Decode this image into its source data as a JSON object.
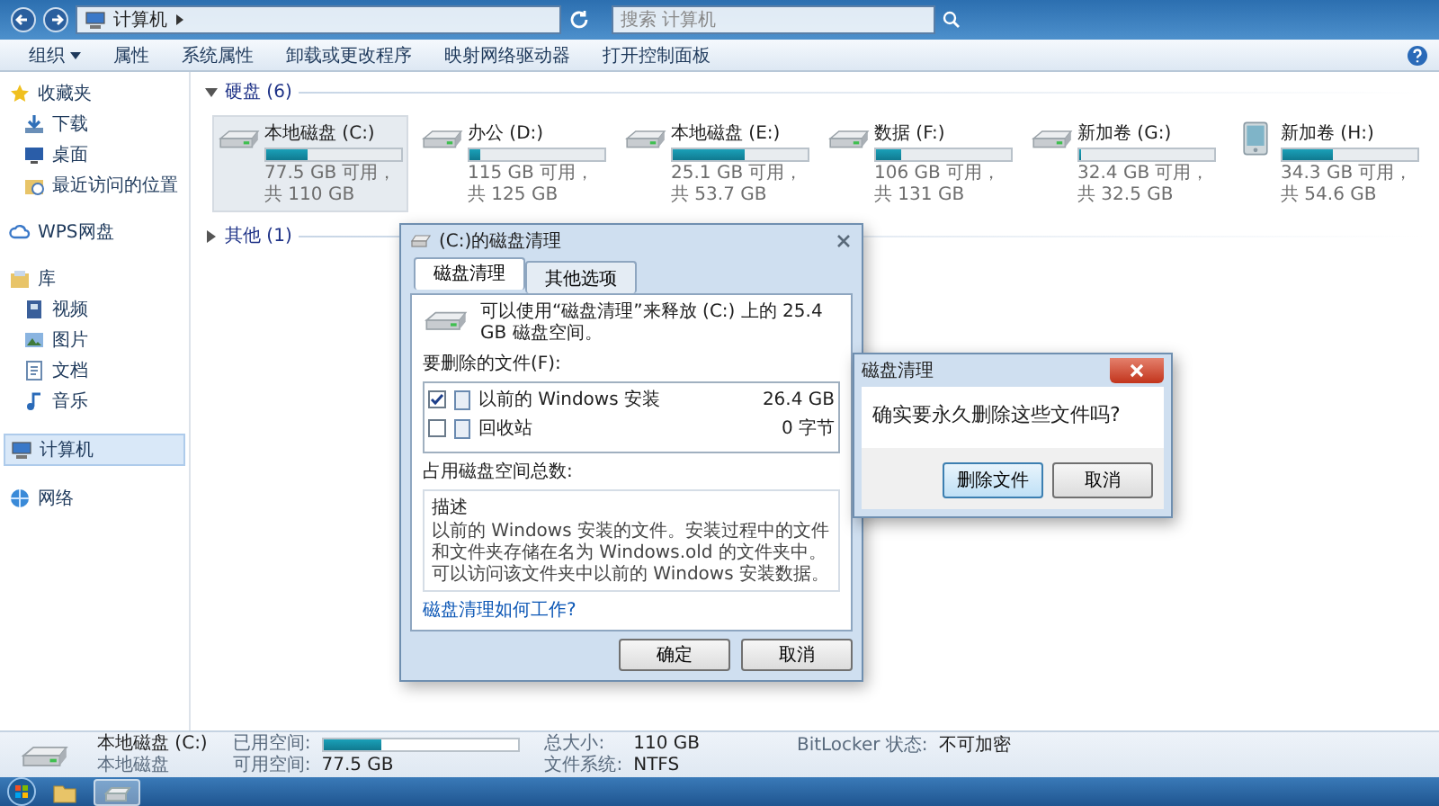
{
  "window": {
    "address": "计算机",
    "search": {
      "placeholder": "搜索 计算机"
    }
  },
  "toolbar": [
    {
      "label": "组织",
      "menu": true
    },
    {
      "label": "属性",
      "menu": false
    },
    {
      "label": "系统属性",
      "menu": false
    },
    {
      "label": "卸载或更改程序",
      "menu": false
    },
    {
      "label": "映射网络驱动器",
      "menu": false
    },
    {
      "label": "打开控制面板",
      "menu": false
    }
  ],
  "sidebar": {
    "groups": [
      {
        "label": "收藏夹",
        "kind": "star",
        "selected": false,
        "children": [
          {
            "label": "下载",
            "kind": "download",
            "selected": false
          },
          {
            "label": "桌面",
            "kind": "desktop",
            "selected": false
          },
          {
            "label": "最近访问的位置",
            "kind": "recent",
            "selected": false
          }
        ]
      },
      {
        "label": "WPS网盘",
        "kind": "cloud",
        "selected": false
      },
      {
        "label": "库",
        "kind": "library",
        "selected": false,
        "children": [
          {
            "label": "视频",
            "kind": "video",
            "selected": false
          },
          {
            "label": "图片",
            "kind": "picture",
            "selected": false
          },
          {
            "label": "文档",
            "kind": "document",
            "selected": false
          },
          {
            "label": "音乐",
            "kind": "music",
            "selected": false
          }
        ]
      },
      {
        "label": "计算机",
        "kind": "computer",
        "selected": true
      },
      {
        "label": "网络",
        "kind": "network",
        "selected": false
      }
    ]
  },
  "groups": [
    {
      "title": "硬盘 (6)",
      "expanded": true,
      "drives": [
        {
          "name": "本地磁盘 (C:)",
          "free": "77.5 GB 可用，共 110 GB",
          "level": 0.3,
          "kind": "hdd",
          "selected": true
        },
        {
          "name": "办公 (D:)",
          "free": "115 GB 可用，共 125 GB",
          "level": 0.08,
          "kind": "hdd",
          "selected": false
        },
        {
          "name": "本地磁盘 (E:)",
          "free": "25.1 GB 可用，共 53.7 GB",
          "level": 0.53,
          "kind": "hdd",
          "selected": false
        },
        {
          "name": "数据 (F:)",
          "free": "106 GB 可用，共 131 GB",
          "level": 0.19,
          "kind": "hdd",
          "selected": false
        },
        {
          "name": "新加卷 (G:)",
          "free": "32.4 GB 可用，共 32.5 GB",
          "level": 0.0,
          "kind": "hdd",
          "selected": false
        },
        {
          "name": "新加卷 (H:)",
          "free": "34.3 GB 可用，共 54.6 GB",
          "level": 0.37,
          "kind": "device",
          "selected": false
        }
      ]
    },
    {
      "title": "其他 (1)",
      "expanded": false
    }
  ],
  "details": {
    "name": "本地磁盘 (C:)",
    "type": "本地磁盘",
    "used_label": "已用空间:",
    "level": 0.3,
    "free_label": "可用空间:",
    "free": "77.5 GB",
    "total_label": "总大小:",
    "total": "110 GB",
    "fs_label": "文件系统:",
    "fs": "NTFS",
    "bitlocker_label": "BitLocker 状态:",
    "bitlocker": "不可加密"
  },
  "taskbar": {
    "apps": [
      {
        "kind": "folder",
        "active": false
      },
      {
        "kind": "cleanup",
        "active": true
      }
    ]
  },
  "cleanup_dialog": {
    "title": "(C:)的磁盘清理",
    "tabs": [
      {
        "label": "磁盘清理",
        "selected": true
      },
      {
        "label": "其他选项",
        "selected": false
      }
    ],
    "summary": "可以使用“磁盘清理”来释放 (C:) 上的 25.4 GB 磁盘空间。",
    "files_label": "要删除的文件(F):",
    "files": [
      {
        "name": "以前的 Windows 安装",
        "size": "26.4 GB",
        "checked": true
      },
      {
        "name": "回收站",
        "size": "0 字节",
        "checked": false
      }
    ],
    "total_label": "占用磁盘空间总数:",
    "description_label": "描述",
    "description": "以前的 Windows 安装的文件。安装过程中的文件和文件夹存储在名为 Windows.old 的文件夹中。可以访问该文件夹中以前的 Windows 安装数据。",
    "link": "磁盘清理如何工作?",
    "buttons": [
      "确定",
      "取消"
    ]
  },
  "message_box": {
    "title": "磁盘清理",
    "message": "确实要永久删除这些文件吗?",
    "buttons": [
      {
        "label": "删除文件",
        "default": true
      },
      {
        "label": "取消",
        "default": false
      }
    ]
  }
}
